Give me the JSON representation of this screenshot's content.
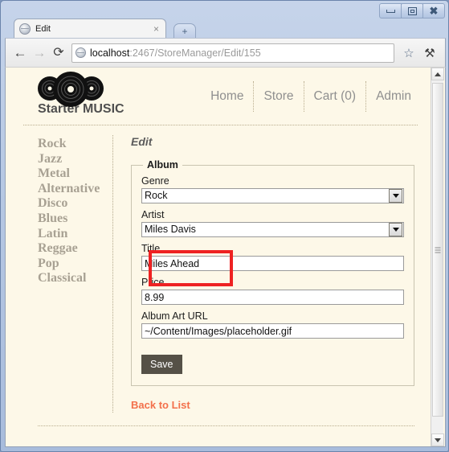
{
  "browser": {
    "window_controls": {
      "minimize": "Minimize",
      "maximize": "Maximize",
      "close": "Close"
    },
    "tab": {
      "title": "Edit",
      "close_label": "×",
      "new_tab_label": "+"
    },
    "toolbar": {
      "back_label": "←",
      "forward_label": "→",
      "reload_label": "⟳",
      "star_label": "☆",
      "wrench_label": "⚒",
      "url_host": "localhost",
      "url_path": ":2467/StoreManager/Edit/155"
    }
  },
  "site": {
    "brand": "Starter MUSIC",
    "nav": [
      {
        "label": "Home"
      },
      {
        "label": "Store"
      },
      {
        "label": "Cart (0)"
      },
      {
        "label": "Admin"
      }
    ]
  },
  "sidebar": {
    "genres": [
      {
        "label": "Rock"
      },
      {
        "label": "Jazz"
      },
      {
        "label": "Metal"
      },
      {
        "label": "Alternative"
      },
      {
        "label": "Disco"
      },
      {
        "label": "Blues"
      },
      {
        "label": "Latin"
      },
      {
        "label": "Reggae"
      },
      {
        "label": "Pop"
      },
      {
        "label": "Classical"
      }
    ]
  },
  "main": {
    "page_title": "Edit",
    "fieldset_legend": "Album",
    "fields": {
      "genre": {
        "label": "Genre",
        "value": "Rock",
        "type": "select"
      },
      "artist": {
        "label": "Artist",
        "value": "Miles Davis",
        "type": "select"
      },
      "title": {
        "label": "Title",
        "value": "Miles Ahead",
        "type": "text"
      },
      "price": {
        "label": "Price",
        "value": "8.99",
        "type": "text"
      },
      "album_art_url": {
        "label": "Album Art URL",
        "value": "~/Content/Images/placeholder.gif",
        "type": "text"
      }
    },
    "save_label": "Save",
    "back_link_label": "Back to List"
  },
  "annotation": {
    "highlight_target": "Genre",
    "color": "#ee2222"
  },
  "colors": {
    "page_background": "#fdf8e8",
    "link_orange": "#f3704b",
    "save_button": "#555147",
    "genre_text": "#a8a193"
  }
}
